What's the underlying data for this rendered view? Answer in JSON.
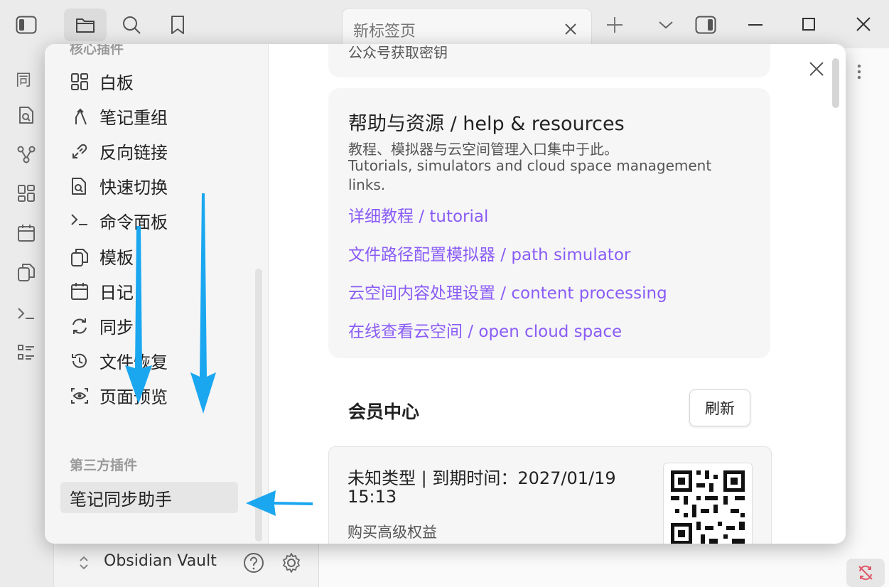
{
  "titlebar": {
    "tab_title": "新标签页"
  },
  "vault": {
    "name": "Obsidian Vault"
  },
  "ribbon": {
    "top_char": "同"
  },
  "settings": {
    "core_section": "核心插件",
    "core_items": [
      {
        "label": "白板",
        "icon": "canvas-icon"
      },
      {
        "label": "笔记重组",
        "icon": "merge-icon"
      },
      {
        "label": "反向链接",
        "icon": "backlink-icon"
      },
      {
        "label": "快速切换",
        "icon": "quick-switch-icon"
      },
      {
        "label": "命令面板",
        "icon": "terminal-icon"
      },
      {
        "label": "模板",
        "icon": "template-icon"
      },
      {
        "label": "日记",
        "icon": "calendar-icon"
      },
      {
        "label": "同步",
        "icon": "sync-icon"
      },
      {
        "label": "文件恢复",
        "icon": "history-icon"
      },
      {
        "label": "页面预览",
        "icon": "preview-icon"
      }
    ],
    "third_party_section": "第三方插件",
    "third_party_items": [
      {
        "label": "笔记同步助手"
      }
    ]
  },
  "main": {
    "top_card_text": "公众号获取密钥",
    "help": {
      "title": "帮助与资源 / help & resources",
      "desc_cn": "教程、模拟器与云空间管理入口集中于此。",
      "desc_en_line1": "Tutorials, simulators and cloud space management",
      "desc_en_line2": "links.",
      "links": [
        "详细教程 / tutorial",
        "文件路径配置模拟器 / path simulator",
        "云空间内容处理设置 / content processing",
        "在线查看云空间 / open cloud space"
      ]
    },
    "member": {
      "title": "会员中心",
      "refresh_label": "刷新",
      "type_line1": "未知类型 | 到期时间：2027/01/19",
      "type_line2": "15:13",
      "buy_label": "购买高级权益"
    }
  },
  "colors": {
    "accent": "#8a5cf6",
    "annotation_arrow": "#1aa7f0",
    "sync_error": "#e05a6a"
  }
}
